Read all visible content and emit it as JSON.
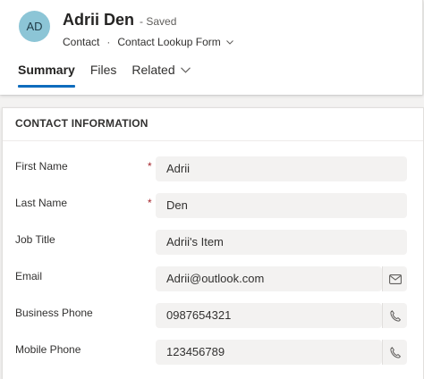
{
  "record": {
    "initials": "AD",
    "name": "Adrii Den",
    "save_state": "- Saved",
    "entity": "Contact",
    "separator": "·",
    "form_name": "Contact Lookup Form"
  },
  "tabs": [
    {
      "label": "Summary"
    },
    {
      "label": "Files"
    },
    {
      "label": "Related"
    }
  ],
  "section": {
    "title": "CONTACT INFORMATION",
    "fields": [
      {
        "label": "First Name",
        "value": "Adrii",
        "required": true
      },
      {
        "label": "Last Name",
        "value": "Den",
        "required": true
      },
      {
        "label": "Job Title",
        "value": "Adrii's Item",
        "required": false
      },
      {
        "label": "Email",
        "value": "Adrii@outlook.com",
        "required": false,
        "action_icon": "mail-icon"
      },
      {
        "label": "Business Phone",
        "value": "0987654321",
        "required": false,
        "action_icon": "phone-icon"
      },
      {
        "label": "Mobile Phone",
        "value": "123456789",
        "required": false,
        "action_icon": "phone-icon"
      }
    ],
    "required_marker": "*"
  },
  "colors": {
    "avatar_bg": "#8cc5d6",
    "accent": "#0f6cbd",
    "required": "#a4262c",
    "field_bg": "#f3f2f1"
  }
}
